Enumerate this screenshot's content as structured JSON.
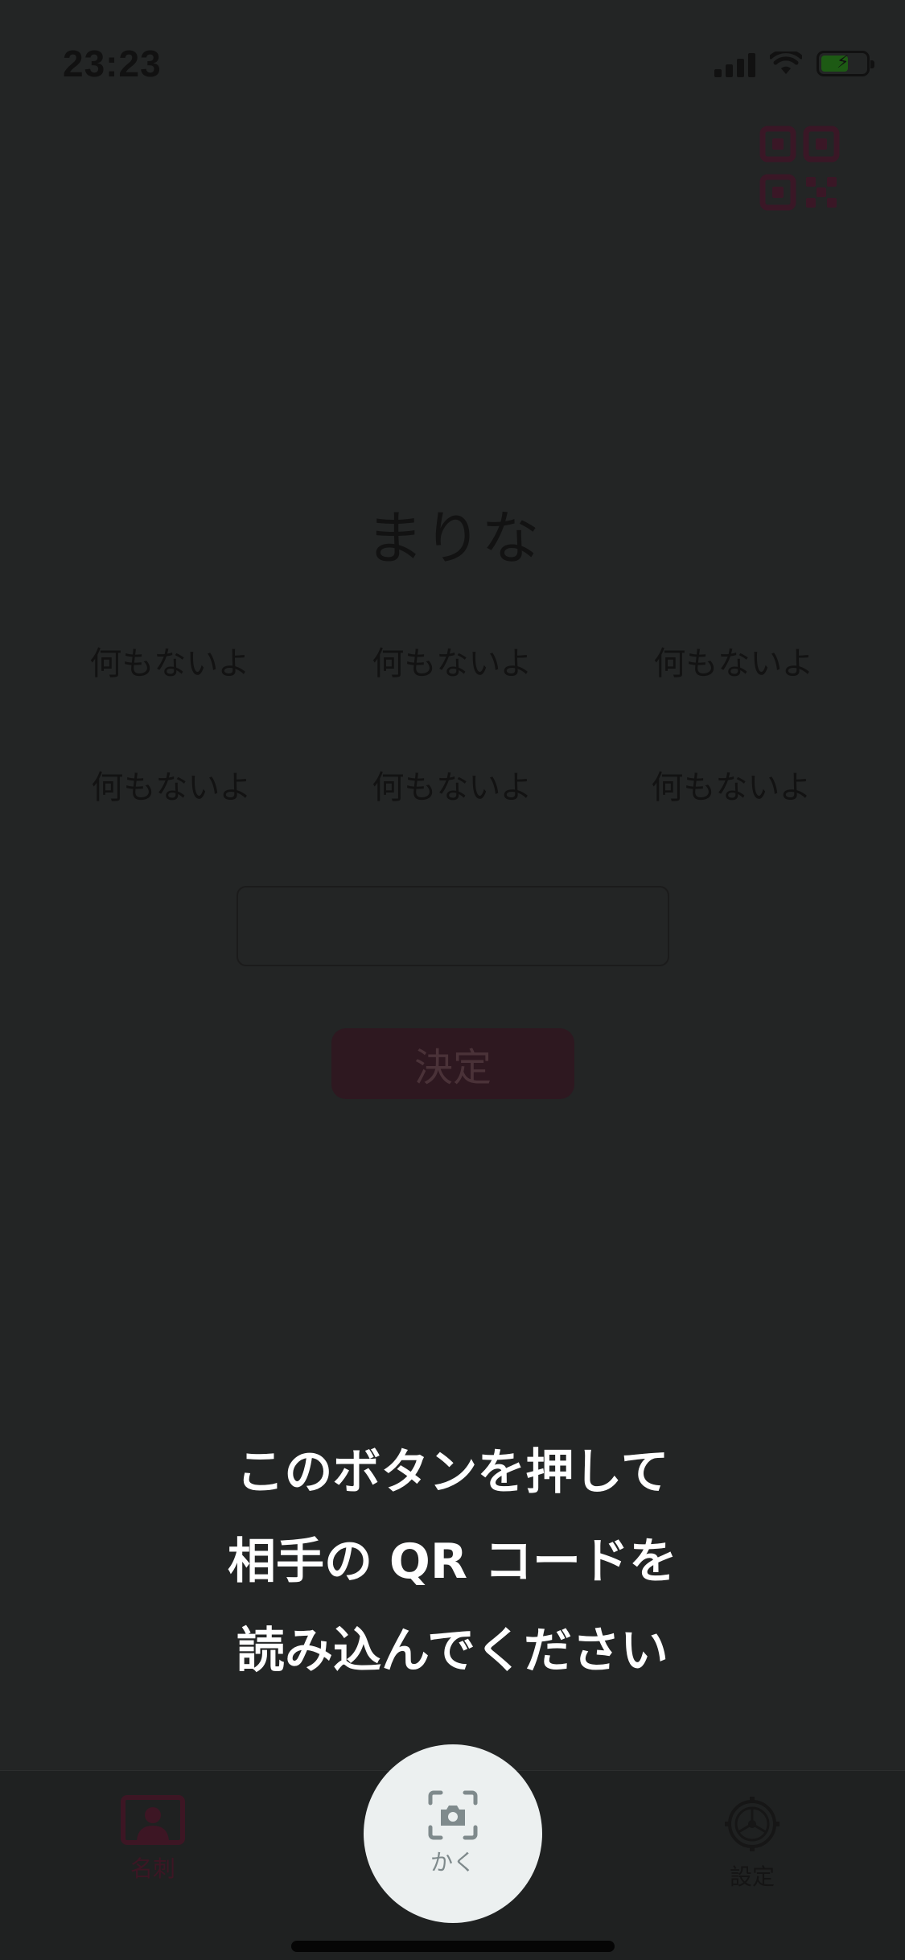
{
  "status_bar": {
    "time": "23:23"
  },
  "header": {
    "qr_icon": "qr-code-icon",
    "accent_color": "#3a1726"
  },
  "profile": {
    "name": "まりな",
    "tags": [
      "何もないよ",
      "何もないよ",
      "何もないよ",
      "何もないよ",
      "何もないよ",
      "何もないよ"
    ]
  },
  "input": {
    "value": "",
    "placeholder": ""
  },
  "submit_label": "決定",
  "tutorial": {
    "line1": "このボタンを押して",
    "line2": "相手の QR コードを",
    "line3": "読み込んでください"
  },
  "tabbar": {
    "meishi_label": "名刺",
    "meishi_icon": "profile-card-icon",
    "center_label": "かく",
    "center_icon": "camera-scan-icon",
    "settings_label": "設定",
    "settings_icon": "gear-icon"
  }
}
